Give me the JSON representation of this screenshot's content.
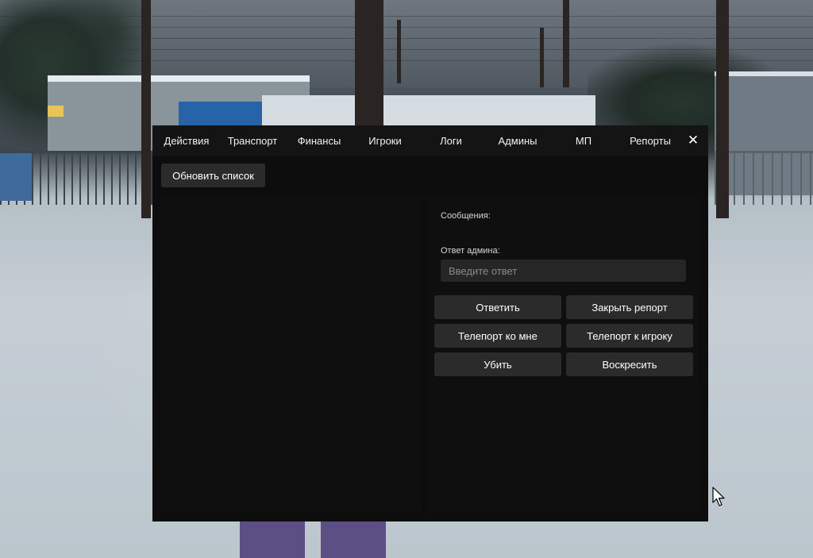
{
  "panel": {
    "tabs": [
      {
        "label": "Действия"
      },
      {
        "label": "Транспорт"
      },
      {
        "label": "Финансы"
      },
      {
        "label": "Игроки"
      },
      {
        "label": "Логи"
      },
      {
        "label": "Админы"
      },
      {
        "label": "МП"
      },
      {
        "label": "Репорты"
      }
    ],
    "close_label": "✕",
    "refresh_label": "Обновить список",
    "messages_label": "Сообщения:",
    "reply_label": "Ответ админа:",
    "reply_value": "",
    "reply_placeholder": "Введите ответ",
    "buttons": {
      "reply": "Ответить",
      "close_report": "Закрыть репорт",
      "tp_to_me": "Телепорт ко мне",
      "tp_to_player": "Телепорт к игроку",
      "kill": "Убить",
      "revive": "Воскресить"
    }
  },
  "colors": {
    "panel_bg": "#0d0d0d",
    "tab_bar_bg": "#141414",
    "button_bg": "#2b2b2b",
    "input_bg": "#262626",
    "text": "#ffffff"
  },
  "icons": {
    "close": "close-icon",
    "cursor": "mouse-cursor-icon"
  }
}
